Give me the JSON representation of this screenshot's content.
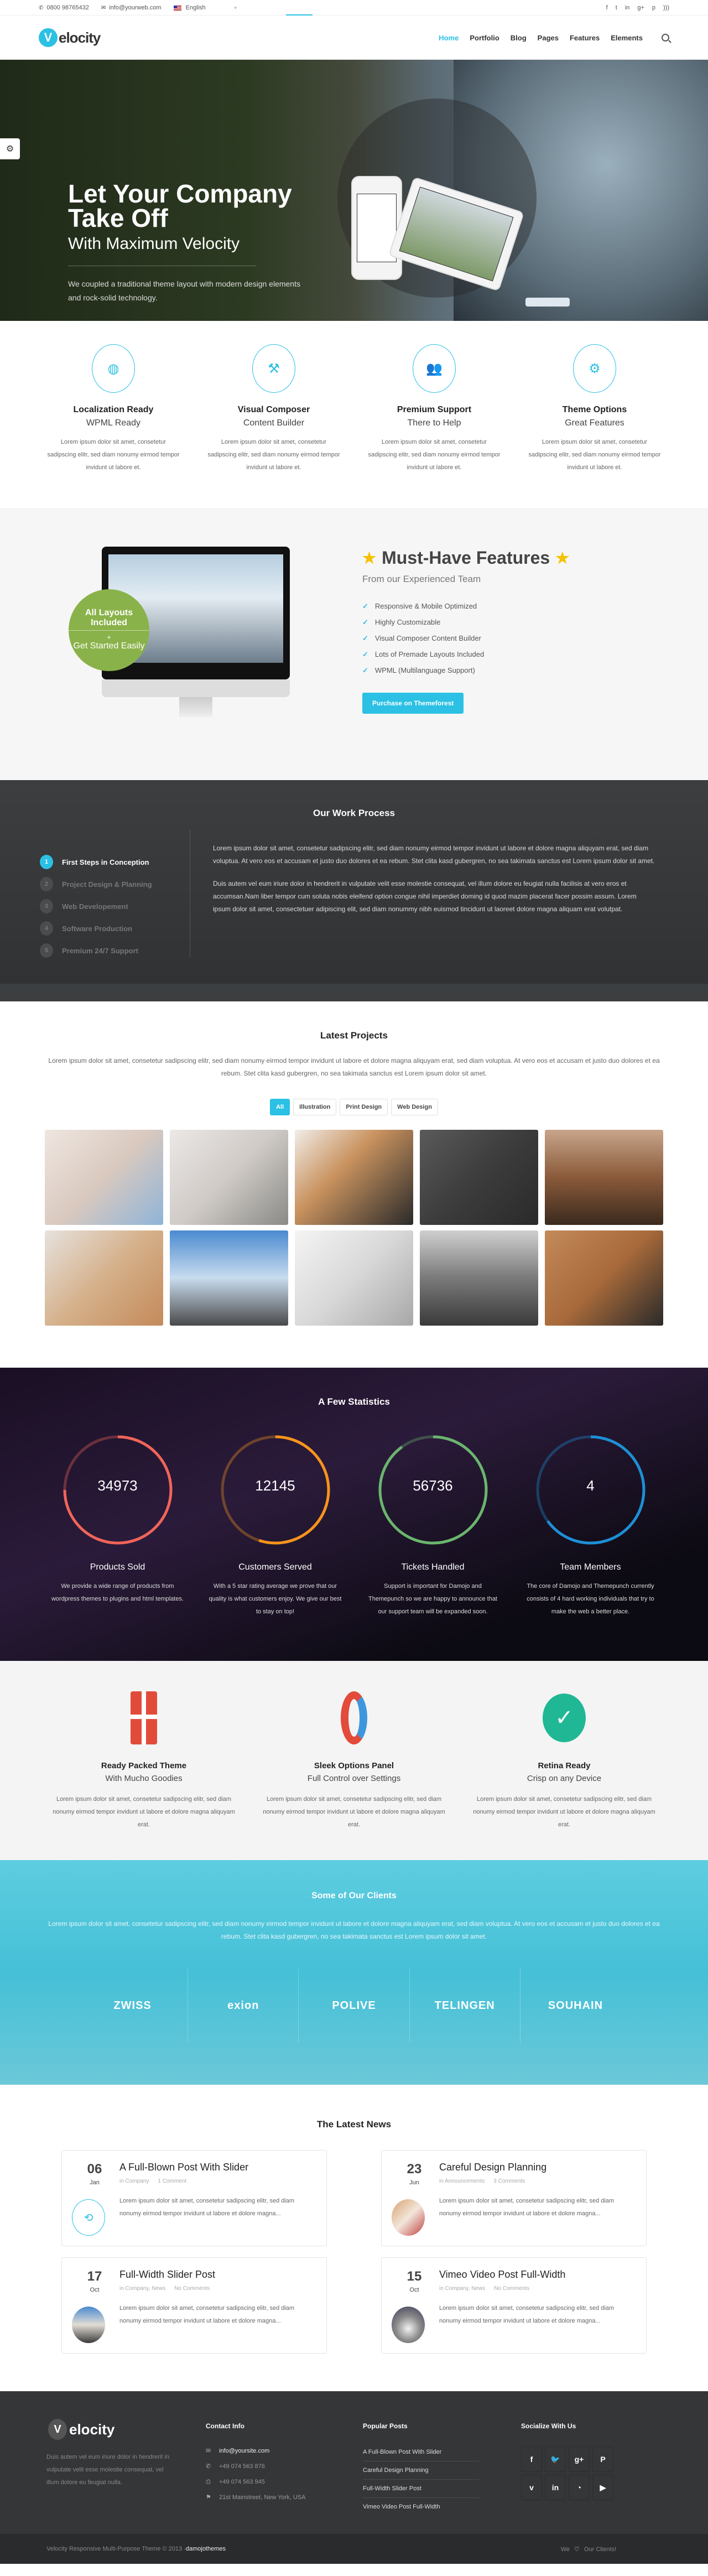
{
  "topbar": {
    "phone": "0800 98765432",
    "email": "info@yourweb.com",
    "language": "English",
    "social": [
      "f",
      "t",
      "in",
      "g+",
      "p",
      "rss"
    ]
  },
  "header": {
    "logo_letter": "V",
    "logo_text": "elocity",
    "nav": [
      "Home",
      "Portfolio",
      "Blog",
      "Pages",
      "Features",
      "Elements"
    ],
    "active_nav": "Home"
  },
  "hero": {
    "title_line1": "Let Your Company",
    "title_line2": "Take Off",
    "subtitle": "With Maximum Velocity",
    "description": "We coupled a traditional theme layout with modern design elements and rock-solid technology.",
    "slides": 3,
    "active_slide": 1
  },
  "features": [
    {
      "icon": "globe-icon",
      "glyph": "◍",
      "title": "Localization Ready",
      "subtitle": "WPML Ready",
      "text": "Lorem ipsum dolor sit amet, consetetur sadipscing elitr, sed diam nonumy eirmod tempor invidunt ut labore et."
    },
    {
      "icon": "tools-icon",
      "glyph": "⚒",
      "title": "Visual Composer",
      "subtitle": "Content Builder",
      "text": "Lorem ipsum dolor sit amet, consetetur sadipscing elitr, sed diam nonumy eirmod tempor invidunt ut labore et."
    },
    {
      "icon": "users-icon",
      "glyph": "👥",
      "title": "Premium Support",
      "subtitle": "There to Help",
      "text": "Lorem ipsum dolor sit amet, consetetur sadipscing elitr, sed diam nonumy eirmod tempor invidunt ut labore et."
    },
    {
      "icon": "gears-icon",
      "glyph": "⚙",
      "title": "Theme Options",
      "subtitle": "Great Features",
      "text": "Lorem ipsum dolor sit amet, consetetur sadipscing elitr, sed diam nonumy eirmod tempor invidunt ut labore et."
    }
  ],
  "musthave": {
    "badge_line1": "All Layouts Included",
    "badge_plus": "+",
    "badge_line2": "Get Started Easily",
    "title": "Must-Have Features",
    "subtitle": "From our Experienced Team",
    "list": [
      "Responsive & Mobile Optimized",
      "Highly Customizable",
      "Visual Composer Content Builder",
      "Lots of Premade Layouts Included",
      "WPML (Multilanguage Support)"
    ],
    "button": "Purchase on Themeforest"
  },
  "process": {
    "title": "Our Work Process",
    "steps": [
      "First Steps in Conception",
      "Project Design & Planning",
      "Web Developement",
      "Software Production",
      "Premium 24/7 Support"
    ],
    "active_step": 1,
    "para1": "Lorem ipsum dolor sit amet, consetetur sadipscing elitr, sed diam nonumy eirmod tempor invidunt ut labore et dolore magna aliquyam erat, sed diam voluptua. At vero eos et accusam et justo duo dolores et ea rebum. Stet clita kasd gubergren, no sea takimata sanctus est Lorem ipsum dolor sit amet.",
    "para2": "Duis autem vel eum iriure dolor in hendrerit in vulputate velit esse molestie consequat, vel illum dolore eu feugiat nulla facilisis at vero eros et accumsan.Nam liber tempor cum soluta nobis eleifend option congue nihil imperdiet doming id quod mazim placerat facer possim assum. Lorem ipsum dolor sit amet, consectetuer adipiscing elit, sed diam nonummy nibh euismod tincidunt ut laoreet dolore magna aliquam erat volutpat."
  },
  "projects": {
    "title": "Latest Projects",
    "lead": "Lorem ipsum dolor sit amet, consetetur sadipscing elitr, sed diam nonumy eirmod tempor invidunt ut labore et dolore magna aliquyam erat, sed diam voluptua. At vero eos et accusam et justo duo dolores et ea rebum. Stet clita kasd gubergren, no sea takimata sanctus est Lorem ipsum dolor sit amet.",
    "filters": [
      "All",
      "Illustration",
      "Print Design",
      "Web Design"
    ],
    "active_filter": "All",
    "tiles": [
      "desk-chart",
      "electronics-parts",
      "notebook-tablet",
      "flatlay-accessories",
      "city-skyscraper",
      "desk-books",
      "road-windmills",
      "laptop-symbol",
      "lighthouse",
      "desk-tablet"
    ]
  },
  "stats": {
    "title": "A Few Statistics",
    "items": [
      {
        "value": "34973",
        "label": "Products Sold",
        "text": "We provide a wide range of products from wordpress themes to plugins and html templates.",
        "color": "#f0645a",
        "fill": 0.75
      },
      {
        "value": "12145",
        "label": "Customers Served",
        "text": "With a 5 star rating average we prove that our quality is what customers enjoy. We give our best to stay on top!",
        "color": "#f7941d",
        "fill": 0.55
      },
      {
        "value": "56736",
        "label": "Tickets Handled",
        "text": "Support is important for Damojo and Themepunch so we are happy to announce that our support team will be expanded soon.",
        "color": "#6ab56e",
        "fill": 0.9
      },
      {
        "value": "4",
        "label": "Team Members",
        "text": "The core of Damojo and Themepunch currently consists of 4 hard working individuals that try to make the web a better place.",
        "color": "#1e8fd6",
        "fill": 0.65
      }
    ]
  },
  "features2": [
    {
      "icon": "gift-icon",
      "title": "Ready Packed Theme",
      "subtitle": "With Mucho Goodies",
      "text": "Lorem ipsum dolor sit amet, consetetur sadipscing elitr, sed diam nonumy eirmod tempor invidunt ut labore et dolore magna aliquyam erat."
    },
    {
      "icon": "pencil-ring-icon",
      "title": "Sleek Options Panel",
      "subtitle": "Full Control over Settings",
      "text": "Lorem ipsum dolor sit amet, consetetur sadipscing elitr, sed diam nonumy eirmod tempor invidunt ut labore et dolore magna aliquyam erat."
    },
    {
      "icon": "checkmark-icon",
      "title": "Retina Ready",
      "subtitle": "Crisp on any Device",
      "text": "Lorem ipsum dolor sit amet, consetetur sadipscing elitr, sed diam nonumy eirmod tempor invidunt ut labore et dolore magna aliquyam erat."
    }
  ],
  "clients": {
    "title": "Some of Our Clients",
    "lead": "Lorem ipsum dolor sit amet, consetetur sadipscing elitr, sed diam nonumy eirmod tempor invidunt ut labore et dolore magna aliquyam erat, sed diam voluptua. At vero eos et accusam et justo duo dolores et ea rebum. Stet clita kasd gubergren, no sea takimata sanctus est Lorem ipsum dolor sit amet.",
    "logos": [
      "ZWISS",
      "exion",
      "POLIVE",
      "TELINGEN",
      "SOUHAIN"
    ]
  },
  "news": {
    "title": "The Latest News",
    "posts": [
      {
        "day": "06",
        "month": "Jan",
        "title": "A Full-Blown Post With Slider",
        "category": "in Company",
        "comments": "1 Comment",
        "excerpt": "Lorem ipsum dolor sit amet, consetetur sadipscing elitr, sed diam nonumy eirmod tempor invidunt ut labore et dolore magna...",
        "thumb": "retweet-icon"
      },
      {
        "day": "23",
        "month": "Jun",
        "title": "Careful Design Planning",
        "category": "in Announcements",
        "comments": "3 Comments",
        "excerpt": "Lorem ipsum dolor sit amet, consetetur sadipscing elitr, sed diam nonumy eirmod tempor invidunt ut labore et dolore magna...",
        "thumb": "desk-photo"
      },
      {
        "day": "17",
        "month": "Oct",
        "title": "Full-Width Slider Post",
        "category": "in Company, News",
        "comments": "No Comments",
        "excerpt": "Lorem ipsum dolor sit amet, consetetur sadipscing elitr, sed diam nonumy eirmod tempor invidunt ut labore et dolore magna...",
        "thumb": "road-photo"
      },
      {
        "day": "15",
        "month": "Oct",
        "title": "Vimeo Video Post Full-Width",
        "category": "in Company, News",
        "comments": "No Comments",
        "excerpt": "Lorem ipsum dolor sit amet, consetetur sadipscing elitr, sed diam nonumy eirmod tempor invidunt ut labore et dolore magna...",
        "thumb": "eagle-photo"
      }
    ]
  },
  "footer": {
    "logo_letter": "V",
    "logo_text": "elocity",
    "about": "Duis autem vel eum iriure dolor in hendrerit in vulputate velit esse molestie consequat, vel illum dolore eu feugiat nulla.",
    "contact_title": "Contact Info",
    "contact": {
      "email": "info@yoursite.com",
      "phone": "+49 074 563 876",
      "fax": "+49 074 563 945",
      "address": "21st Mainstreet, New York, USA"
    },
    "popular_title": "Popular Posts",
    "popular": [
      "A Full-Blown Post With Slider",
      "Careful Design Planning",
      "Full-Width Slider Post",
      "Vimeo Video Post Full-Width"
    ],
    "social_title": "Socialize With Us",
    "social": [
      {
        "name": "facebook-icon",
        "glyph": "f"
      },
      {
        "name": "twitter-icon",
        "glyph": "🐦"
      },
      {
        "name": "google-plus-icon",
        "glyph": "g+"
      },
      {
        "name": "pinterest-icon",
        "glyph": "P"
      },
      {
        "name": "vimeo-icon",
        "glyph": "v"
      },
      {
        "name": "linkedin-icon",
        "glyph": "in"
      },
      {
        "name": "rss-icon",
        "glyph": "◔"
      },
      {
        "name": "youtube-icon",
        "glyph": "▶"
      }
    ],
    "copyright": "Velocity Responsive Multi-Purpose Theme © 2013 - ",
    "copyright_brand": "damojothemes",
    "love_we": "We",
    "love_clients": "Our Clients!"
  },
  "colors": {
    "accent": "#2bc0e4",
    "green": "#8ab24a",
    "star": "#f6c100",
    "dark": "#343638"
  }
}
